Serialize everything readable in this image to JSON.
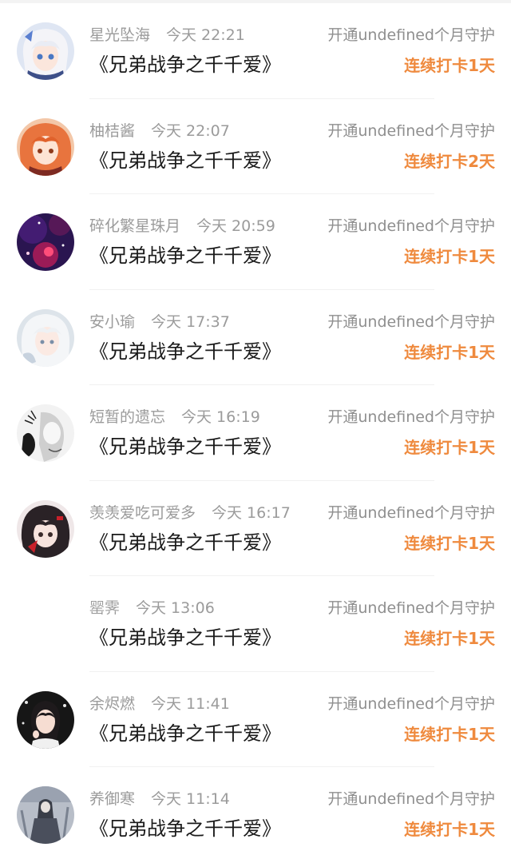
{
  "records": [
    {
      "username": "星光坠海",
      "time": "今天 22:21",
      "action": "开通undefined个月守护",
      "book": "《兄弟战争之千千爱》",
      "streak": "连续打卡1天",
      "avatar": "anime-girl-white-hair-avatar"
    },
    {
      "username": "柚桔酱",
      "time": "今天 22:07",
      "action": "开通undefined个月守护",
      "book": "《兄弟战争之千千爱》",
      "streak": "连续打卡2天",
      "avatar": "anime-girl-orange-hair-avatar"
    },
    {
      "username": "碎化繁星珠月",
      "time": "今天 20:59",
      "action": "开通undefined个月守护",
      "book": "《兄弟战争之千千爱》",
      "streak": "连续打卡1天",
      "avatar": "purple-galaxy-avatar"
    },
    {
      "username": "安小瑜",
      "time": "今天 17:37",
      "action": "开通undefined个月守护",
      "book": "《兄弟战争之千千爱》",
      "streak": "连续打卡1天",
      "avatar": "white-hair-girl-avatar"
    },
    {
      "username": "短暂的遗忘",
      "time": "今天 16:19",
      "action": "开通undefined个月守护",
      "book": "《兄弟战争之千千爱》",
      "streak": "连续打卡1天",
      "avatar": "monochrome-sketch-avatar"
    },
    {
      "username": "羡羡爱吃可爱多",
      "time": "今天 16:17",
      "action": "开通undefined个月守护",
      "book": "《兄弟战争之千千爱》",
      "streak": "连续打卡1天",
      "avatar": "dark-hair-anime-avatar"
    },
    {
      "username": "罂霁",
      "time": "今天 13:06",
      "action": "开通undefined个月守护",
      "book": "《兄弟战争之千千爱》",
      "streak": "连续打卡1天",
      "avatar": ""
    },
    {
      "username": "余烬燃",
      "time": "今天 11:41",
      "action": "开通undefined个月守护",
      "book": "《兄弟战争之千千爱》",
      "streak": "连续打卡1天",
      "avatar": "photo-girl-avatar"
    },
    {
      "username": "养御寒",
      "time": "今天 11:14",
      "action": "开通undefined个月守护",
      "book": "《兄弟战争之千千爱》",
      "streak": "连续打卡1天",
      "avatar": "grey-figure-avatar"
    }
  ],
  "colors": {
    "streak": "#ef8a3e",
    "meta_text": "#9b9b9b",
    "title_text": "#1a1a1a",
    "divider": "#f1f1f1"
  }
}
